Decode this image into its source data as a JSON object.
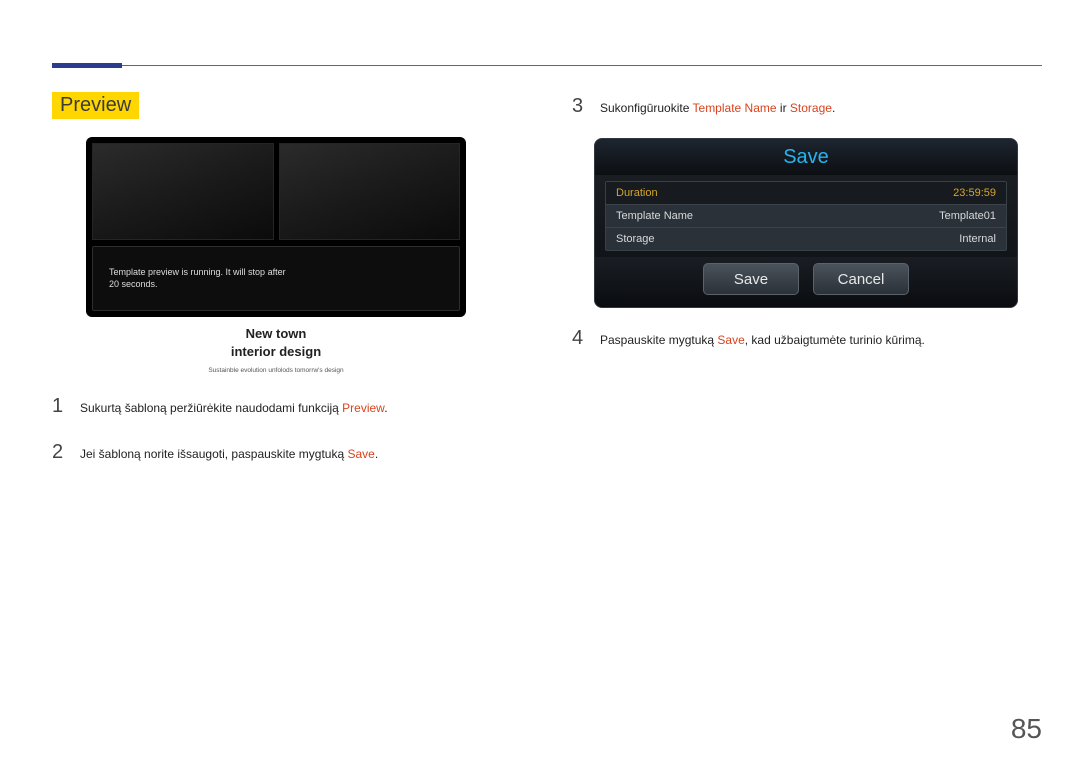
{
  "page_number": "85",
  "section_title": "Preview",
  "preview_message": "Template preview is running. It will stop after\n20 seconds.",
  "caption_line1": "New town",
  "caption_line2": "interior design",
  "caption_sub": "Sustainble evolution unfolods tomorrw's design",
  "steps_left": {
    "s1": {
      "num": "1",
      "pre": "Sukurtą šabloną peržiūrėkite naudodami funkciją ",
      "hl": "Preview",
      "post": "."
    },
    "s2": {
      "num": "2",
      "pre": "Jei šabloną norite išsaugoti, paspauskite mygtuką ",
      "hl": "Save",
      "post": "."
    }
  },
  "steps_right": {
    "s3": {
      "num": "3",
      "pre": "Sukonfigūruokite ",
      "hl1": "Template Name",
      "mid": " ir ",
      "hl2": "Storage",
      "post": "."
    },
    "s4": {
      "num": "4",
      "pre": "Paspauskite mygtuką ",
      "hl": "Save",
      "post": ", kad užbaigtumėte turinio kūrimą."
    }
  },
  "dialog": {
    "title": "Save",
    "rows": [
      {
        "label": "Duration",
        "value": "23:59:59"
      },
      {
        "label": "Template Name",
        "value": "Template01"
      },
      {
        "label": "Storage",
        "value": "Internal"
      }
    ],
    "save_btn": "Save",
    "cancel_btn": "Cancel"
  }
}
